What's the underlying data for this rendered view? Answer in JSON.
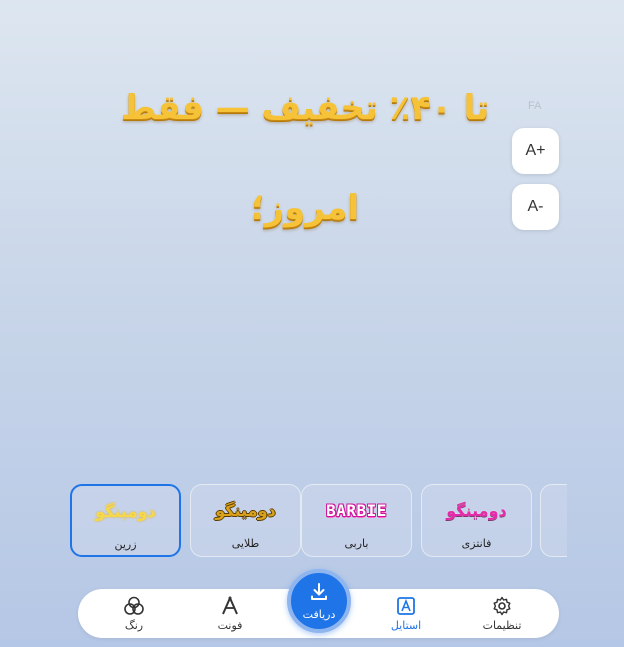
{
  "language_badge": "FA",
  "font_size_controls": {
    "increase": "A+",
    "decrease": "A-"
  },
  "preview_text": {
    "line1": "تا ۴۰٪ تخفیف — فقط",
    "line2": "امروز؛"
  },
  "styles": [
    {
      "id": "zarrin",
      "preview": "دومینگو",
      "label": "زرین",
      "selected": true
    },
    {
      "id": "talayi",
      "preview": "دومینگو",
      "label": "طلایی",
      "selected": false
    },
    {
      "id": "barbie",
      "preview": "BARBIE",
      "label": "باربی",
      "selected": false
    },
    {
      "id": "fantasy",
      "preview": "دومینگو",
      "label": "فانتزی",
      "selected": false
    }
  ],
  "bottom_nav": {
    "color": "رنگ",
    "font": "فونت",
    "download": "دریافت",
    "style": "استایل",
    "settings": "تنظیمات",
    "active": "style"
  },
  "colors": {
    "accent": "#1f74e8",
    "gold_text": "#f6c338",
    "barbie_pink": "#d0169c",
    "fantasy_magenta": "#e42aa8"
  },
  "icons": {
    "color": "color-circles-icon",
    "font": "font-letter-icon",
    "download": "download-icon",
    "style": "style-frame-icon",
    "settings": "gear-icon"
  }
}
